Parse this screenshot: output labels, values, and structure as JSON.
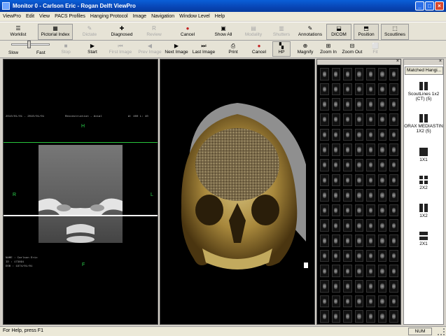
{
  "window": {
    "title": "Monitor 0 - Carlson Eric - Rogan Delft ViewPro",
    "min": "_",
    "max": "□",
    "close": "×"
  },
  "menu": [
    "ViewPro",
    "Edit",
    "View",
    "PACS Profiles",
    "Hanging Protocol",
    "Image",
    "Navigation",
    "Window Level",
    "Help"
  ],
  "toolbar1": {
    "worklist": "Worklist",
    "pictorial_index": "Pictorial Index",
    "dictate": "Dictate",
    "diagnosed": "Diagnosed",
    "review": "Review",
    "cancel": "Cancel",
    "show_all": "Show All",
    "modality": "Modality",
    "shutters": "Shutters",
    "annotations": "Annotations",
    "dicom": "DICOM",
    "position": "Position",
    "scoutlines": "Scoutlines"
  },
  "toolbar2": {
    "slow": "Slow",
    "fast": "Fast",
    "stop": "Stop",
    "start": "Start",
    "first_image": "First Image",
    "prev_image": "Prev Image",
    "next_image": "Next Image",
    "last_image": "Last Image",
    "print": "Print",
    "cancel": "Cancel",
    "hp": "HP",
    "magnify": "Magnify",
    "zoom_in": "Zoom In",
    "zoom_out": "Zoom Out",
    "fit": "Fit"
  },
  "viewer": {
    "orient_top": "H",
    "orient_left": "R",
    "orient_right": "L",
    "orient_bottom": "F",
    "patient_name": "NAME : Carlson Eric",
    "patient_id": "ID : 173891",
    "patient_dob": "DOB : 1974/01/01",
    "header_left": "2010/01/01 - 2010/01/01",
    "header_mid": "Reconstruction - Axial",
    "header_right": "W: 400 L: 40"
  },
  "hanging_protocols": {
    "tab": "Matched Hangi...",
    "items": [
      "ScoutLines 1x2 (CT) (5)",
      "ORAX MEDIASTIN 1X2 (5)",
      "1X1",
      "2X2",
      "1X2",
      "2X1"
    ]
  },
  "status": {
    "help": "For Help, press F1",
    "num": "NUM"
  }
}
